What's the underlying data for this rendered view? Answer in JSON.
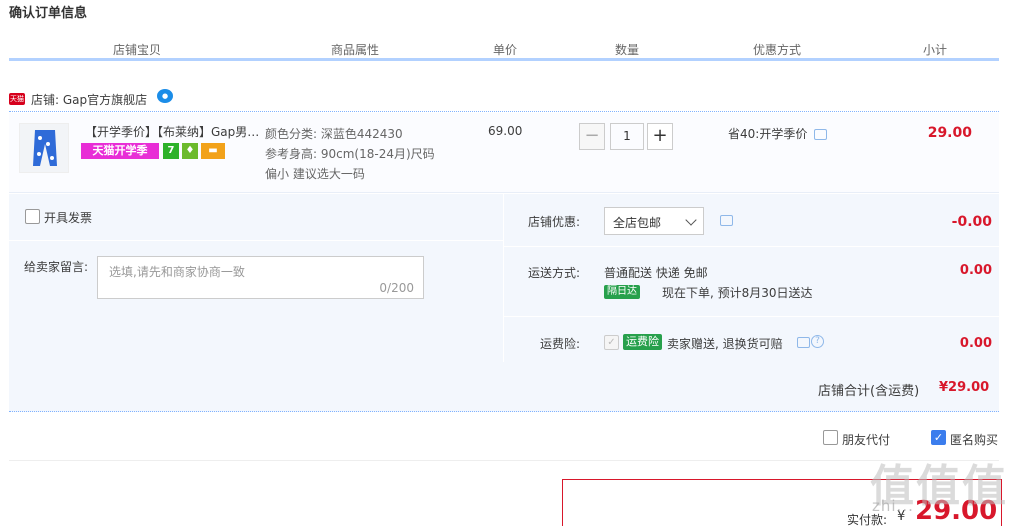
{
  "page": {
    "title": "确认订单信息"
  },
  "columns": [
    "店铺宝贝",
    "商品属性",
    "单价",
    "数量",
    "优惠方式",
    "小计"
  ],
  "shop": {
    "badge": "天猫",
    "name": "店铺: Gap官方旗舰店"
  },
  "item": {
    "title": "【开学季价】【布莱纳】Gap男…",
    "promo_badge": "天猫开学季",
    "attr_color": "颜色分类: 深蓝色442430",
    "attr_height": "参考身高: 90cm(18-24月)尺码",
    "attr_note": "偏小 建议选大一码",
    "unit_price": "69.00",
    "quantity": "1",
    "minus_label": "−",
    "plus_label": "+",
    "discount": "省40:开学季价",
    "subtotal": "29.00"
  },
  "invoice": {
    "label": "开具发票"
  },
  "memo": {
    "label": "给卖家留言:",
    "placeholder": "选填,请先和商家协商一致",
    "counter": "0/200"
  },
  "shop_discount": {
    "label": "店铺优惠:",
    "selected": "全店包邮",
    "amount": "-0.00"
  },
  "shipping": {
    "label": "运送方式:",
    "method": "普通配送 快递 免邮",
    "badge": "隔日达",
    "eta": "现在下单, 预计8月30日送达",
    "amount": "0.00"
  },
  "insurance": {
    "label": "运费险:",
    "badge": "运费险",
    "text": "卖家赠送, 退换货可赔",
    "amount": "0.00"
  },
  "shop_total": {
    "label": "店铺合计(含运费)",
    "amount": "¥29.00"
  },
  "options": {
    "friend_pay": "朋友代付",
    "anonymous": "匿名购买"
  },
  "payment": {
    "label": "实付款:",
    "currency": "¥",
    "amount": "29.00"
  },
  "watermark": {
    "text": "值值值",
    "sub": "zhi..."
  },
  "colors": {
    "accent": "#d8172b",
    "header_line": "#b2d1ff",
    "panel_bg": "#f3f7fd",
    "tmall_red": "#d6001c"
  }
}
